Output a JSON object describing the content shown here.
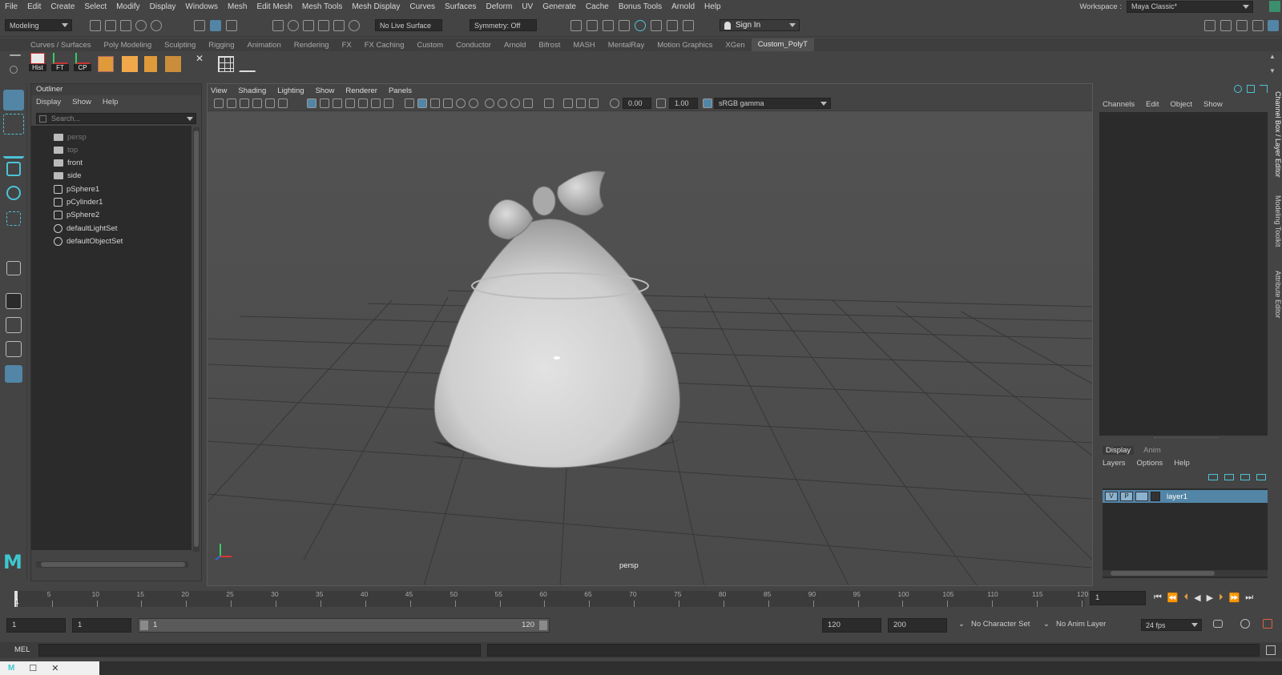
{
  "menubar": {
    "items": [
      "File",
      "Edit",
      "Create",
      "Select",
      "Modify",
      "Display",
      "Windows",
      "Mesh",
      "Edit Mesh",
      "Mesh Tools",
      "Mesh Display",
      "Curves",
      "Surfaces",
      "Deform",
      "UV",
      "Generate",
      "Cache",
      "Bonus Tools",
      "Arnold",
      "Help"
    ],
    "workspace_label": "Workspace :",
    "workspace_value": "Maya Classic*"
  },
  "statusline": {
    "menuset": "Modeling",
    "live_surface": "No Live Surface",
    "symmetry": "Symmetry: Off",
    "sign_in": "Sign In"
  },
  "shelf": {
    "tabs": [
      "Curves / Surfaces",
      "Poly Modeling",
      "Sculpting",
      "Rigging",
      "Animation",
      "Rendering",
      "FX",
      "FX Caching",
      "Custom",
      "Conductor",
      "Arnold",
      "Bifrost",
      "MASH",
      "MentalRay",
      "Motion Graphics",
      "XGen",
      "Custom_PolyT"
    ],
    "active_tab": "Custom_PolyT",
    "buttons": [
      "Hist",
      "FT",
      "CP"
    ]
  },
  "outliner": {
    "title": "Outliner",
    "menu": [
      "Display",
      "Show",
      "Help"
    ],
    "search_placeholder": "Search...",
    "items": [
      {
        "label": "persp",
        "dim": true
      },
      {
        "label": "top",
        "dim": true
      },
      {
        "label": "front",
        "dim": false
      },
      {
        "label": "side",
        "dim": false
      },
      {
        "label": "pSphere1",
        "dim": false
      },
      {
        "label": "pCylinder1",
        "dim": false
      },
      {
        "label": "pSphere2",
        "dim": false
      },
      {
        "label": "defaultLightSet",
        "dim": false
      },
      {
        "label": "defaultObjectSet",
        "dim": false
      }
    ]
  },
  "viewport": {
    "menu": [
      "View",
      "Shading",
      "Lighting",
      "Show",
      "Renderer",
      "Panels"
    ],
    "exposure": "0.00",
    "gamma": "1.00",
    "colorspace": "sRGB gamma",
    "camera_label": "persp"
  },
  "channelbox": {
    "menu": [
      "Channels",
      "Edit",
      "Object",
      "Show"
    ]
  },
  "layer_editor": {
    "tabs": [
      "Display",
      "Anim"
    ],
    "active_tab": "Display",
    "menu": [
      "Layers",
      "Options",
      "Help"
    ],
    "layer": {
      "v": "V",
      "p": "P",
      "name": "layer1"
    }
  },
  "side_tabs": [
    "Channel Box / Layer Editor",
    "Modeling Toolkit",
    "Attribute Editor"
  ],
  "timeslider": {
    "ticks": [
      1,
      5,
      10,
      15,
      20,
      25,
      30,
      35,
      40,
      45,
      50,
      55,
      60,
      65,
      70,
      75,
      80,
      85,
      90,
      95,
      100,
      105,
      110,
      115,
      120
    ],
    "current_frame": "1"
  },
  "range": {
    "start": "1",
    "playback_start": "1",
    "slider_start": "1",
    "slider_end": "120",
    "playback_end": "120",
    "end": "200",
    "character_set": "No Character Set",
    "anim_layer": "No Anim Layer",
    "fps": "24 fps"
  },
  "cmdline": {
    "label": "MEL"
  }
}
